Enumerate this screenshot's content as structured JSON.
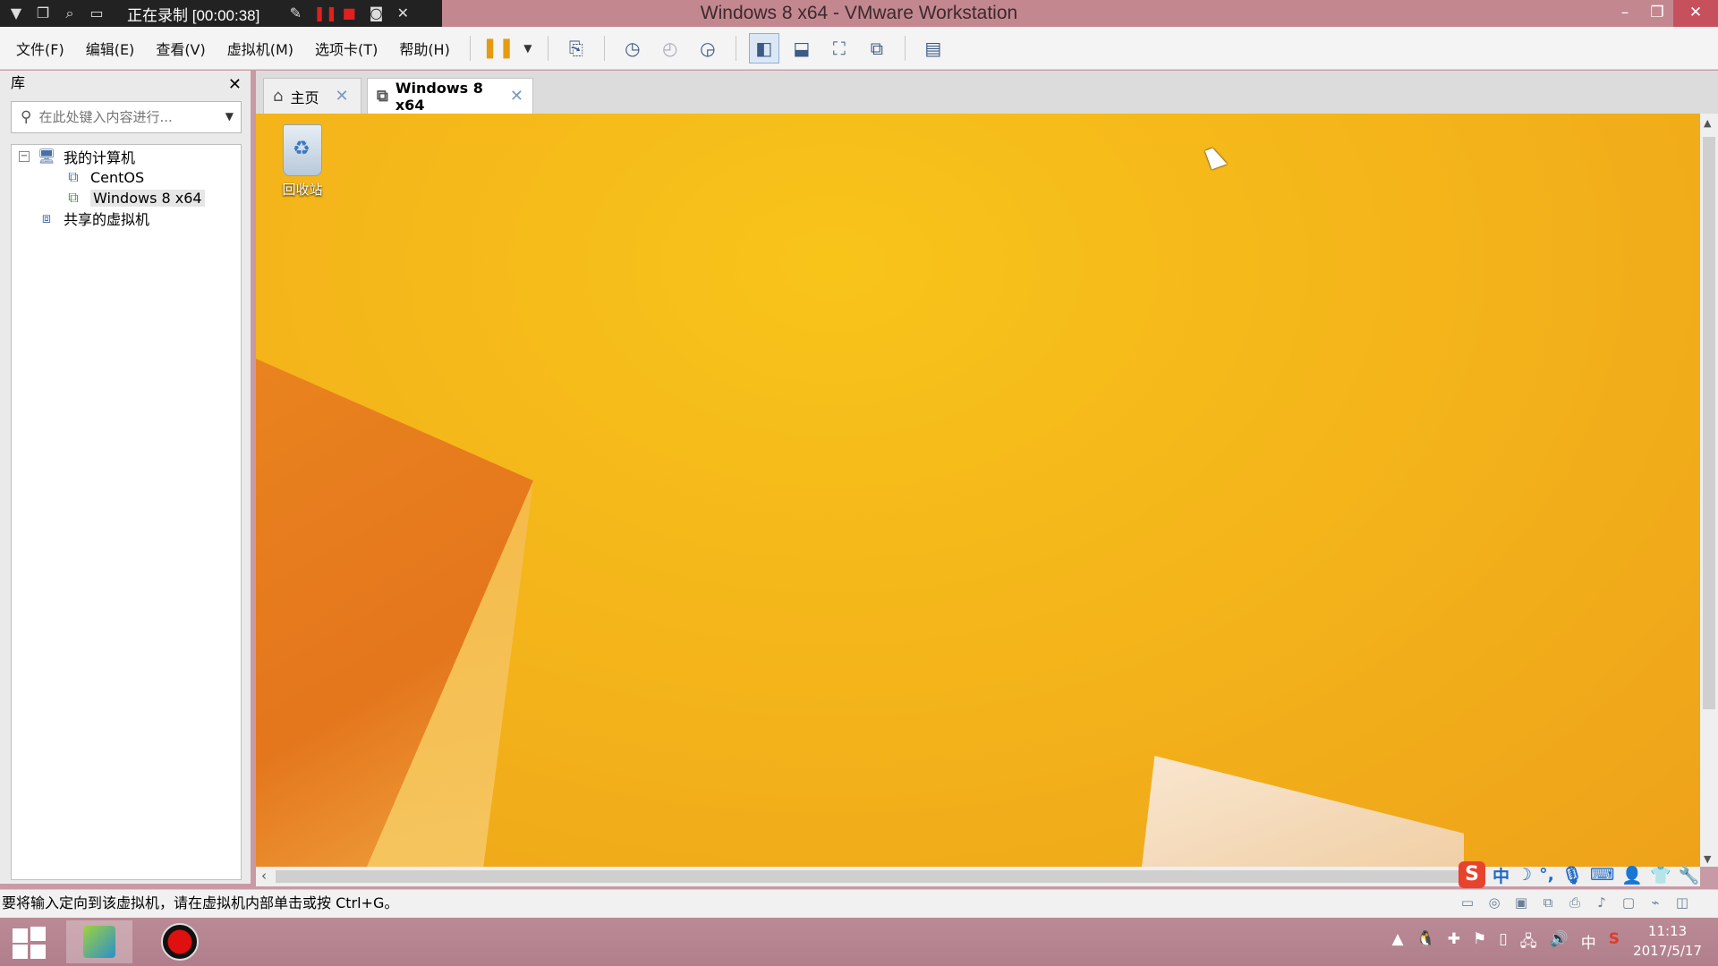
{
  "window": {
    "title": "Windows 8 x64 - VMware Workstation",
    "recording_label": "正在录制 [00:00:38]"
  },
  "menu": {
    "file": "文件(F)",
    "edit": "编辑(E)",
    "view": "查看(V)",
    "vm": "虚拟机(M)",
    "tabs": "选项卡(T)",
    "help": "帮助(H)"
  },
  "library": {
    "title": "库",
    "search_placeholder": "在此处键入内容进行...",
    "tree": [
      {
        "label": "我的计算机",
        "level": 0
      },
      {
        "label": "CentOS",
        "level": 1
      },
      {
        "label": "Windows 8 x64",
        "level": 1,
        "selected": true
      },
      {
        "label": "共享的虚拟机",
        "level": 0
      }
    ]
  },
  "tabs": [
    {
      "label": "主页",
      "active": false
    },
    {
      "label": "Windows 8 x64",
      "active": true
    }
  ],
  "guest_desktop": {
    "recycle_bin_label": "回收站"
  },
  "statusbar": {
    "message": "要将输入定向到该虚拟机，请在虚拟机内部单击或按 Ctrl+G。"
  },
  "ime": {
    "mode": "中"
  },
  "host_taskbar": {
    "tray_lang": "中",
    "time": "11:13",
    "date": "2017/5/17"
  },
  "colors": {
    "titlebar": "#c38790",
    "desktop_yellow": "#f3b21a",
    "accent": "#3d5a85"
  }
}
